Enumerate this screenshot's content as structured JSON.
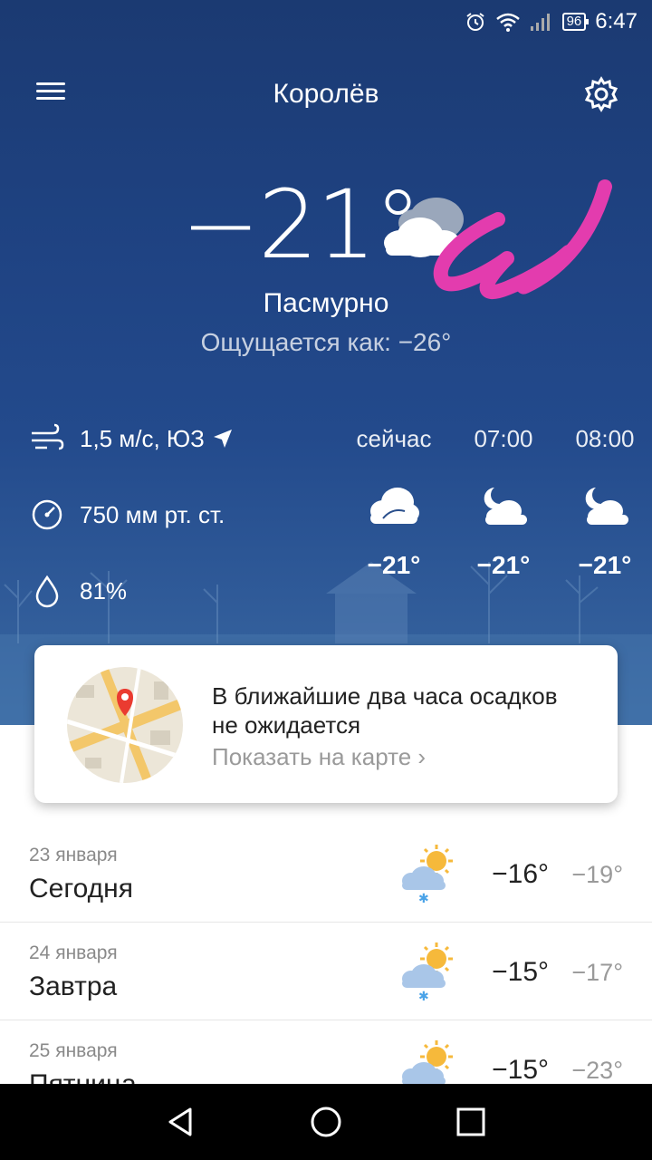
{
  "status_bar": {
    "battery": "96",
    "time": "6:47"
  },
  "header": {
    "city": "Королёв"
  },
  "current": {
    "temperature": "−21°",
    "condition": "Пасмурно",
    "feels_like": "Ощущается как: −26°",
    "wind": "1,5 м/с, ЮЗ",
    "pressure": "750 мм рт. ст.",
    "humidity": "81%"
  },
  "hourly": [
    {
      "time": "сейчас",
      "temp": "−21°",
      "icon": "cloudy-icon"
    },
    {
      "time": "07:00",
      "temp": "−21°",
      "icon": "moon-cloud-icon"
    },
    {
      "time": "08:00",
      "temp": "−21°",
      "icon": "moon-cloud-icon"
    }
  ],
  "nowcast": {
    "title": "В ближайшие два часа осадков не ожидается",
    "link": "Показать на карте ›"
  },
  "forecast": [
    {
      "date": "23 января",
      "day": "Сегодня",
      "max": "−16°",
      "min": "−19°",
      "icon": "sun-cloud-snow-icon"
    },
    {
      "date": "24 января",
      "day": "Завтра",
      "max": "−15°",
      "min": "−17°",
      "icon": "sun-cloud-snow-icon"
    },
    {
      "date": "25 января",
      "day": "Пятница",
      "max": "−15°",
      "min": "−23°",
      "icon": "sun-cloud-icon"
    }
  ],
  "colors": {
    "hero_top": "#1b3a72",
    "hero_bottom": "#3b6aa3",
    "scribble": "#e33cae"
  }
}
